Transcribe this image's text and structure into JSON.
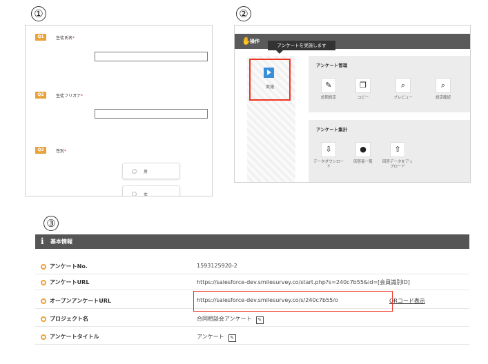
{
  "markers": {
    "one": "①",
    "two": "②",
    "three": "③"
  },
  "panel1": {
    "questions": [
      {
        "badge": "Q1",
        "label": "生徒氏名",
        "required": "*"
      },
      {
        "badge": "Q2",
        "label": "生徒フリガナ",
        "required": "*"
      },
      {
        "badge": "Q3",
        "label": "性別",
        "required": "*"
      }
    ],
    "options": [
      "男",
      "女"
    ]
  },
  "panel2": {
    "header_title": "操作",
    "tooltip": "アンケートを実施します",
    "execute_label": "実施",
    "management": {
      "title": "アンケート管理",
      "tools": [
        {
          "icon": "edit-icon",
          "label": "設問設定"
        },
        {
          "icon": "copy-icon",
          "label": "コピー"
        },
        {
          "icon": "preview-icon",
          "label": "プレビュー"
        },
        {
          "icon": "settings-check-icon",
          "label": "設定確認"
        }
      ]
    },
    "aggregation": {
      "title": "アンケート集計",
      "tools": [
        {
          "icon": "download-icon",
          "label": "データダウンロード"
        },
        {
          "icon": "respondents-icon",
          "label": "回答者一覧"
        },
        {
          "icon": "upload-icon",
          "label": "回答データをアップロード"
        }
      ]
    }
  },
  "panel3": {
    "header_title": "基本情報",
    "rows": [
      {
        "label": "アンケートNo.",
        "value": "1593125920-2"
      },
      {
        "label": "アンケートURL",
        "value": "https://salesforce-dev.smilesurvey.co/start.php?s=240c7b55&id=[会員識別ID]"
      },
      {
        "label": "オープンアンケートURL",
        "value": "https://salesforce-dev.smilesurvey.co/s/240c7b55/o",
        "link": "QRコード表示"
      },
      {
        "label": "プロジェクト名",
        "value": "合同相談会アンケート"
      },
      {
        "label": "アンケートタイトル",
        "value": "アンケート"
      }
    ]
  },
  "colors": {
    "accent": "#e8a23a",
    "highlight": "#e32222",
    "header": "#555555",
    "blue": "#3a8fd9"
  }
}
